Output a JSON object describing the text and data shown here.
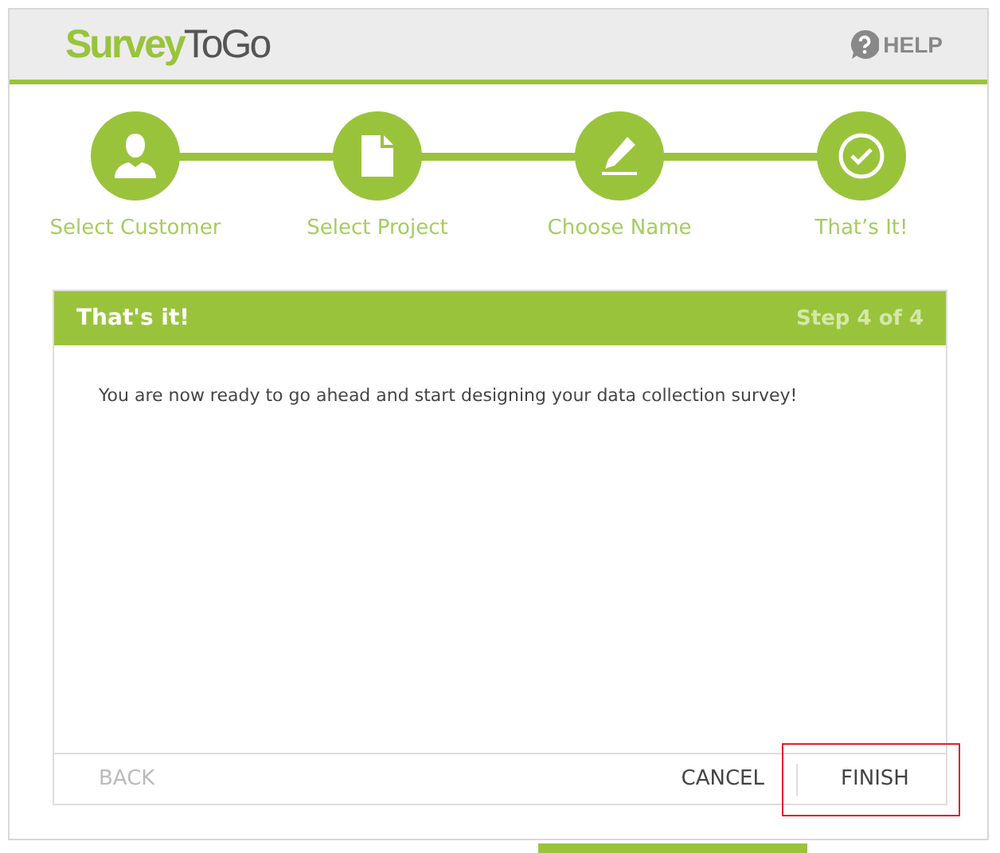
{
  "header": {
    "logo": {
      "primary": "Survey",
      "secondary": "ToGo"
    },
    "help": "HELP"
  },
  "steps": [
    {
      "label": "Select Customer",
      "kind": "person",
      "completed": true
    },
    {
      "label": "Select Project",
      "kind": "document",
      "completed": true
    },
    {
      "label": "Choose Name",
      "kind": "pencil",
      "completed": true
    },
    {
      "label": "That’s It!",
      "kind": "check",
      "completed": true
    }
  ],
  "panel": {
    "title": "That's it!",
    "step": "Step 4 of 4",
    "message": "You are now ready to go ahead and start designing your data collection survey!"
  },
  "footer": {
    "back": {
      "label": "BACK",
      "disabled": true
    },
    "cancel": {
      "label": "CANCEL",
      "disabled": false
    },
    "finish": {
      "label": "FINISH",
      "disabled": false,
      "highlighted": true
    }
  }
}
